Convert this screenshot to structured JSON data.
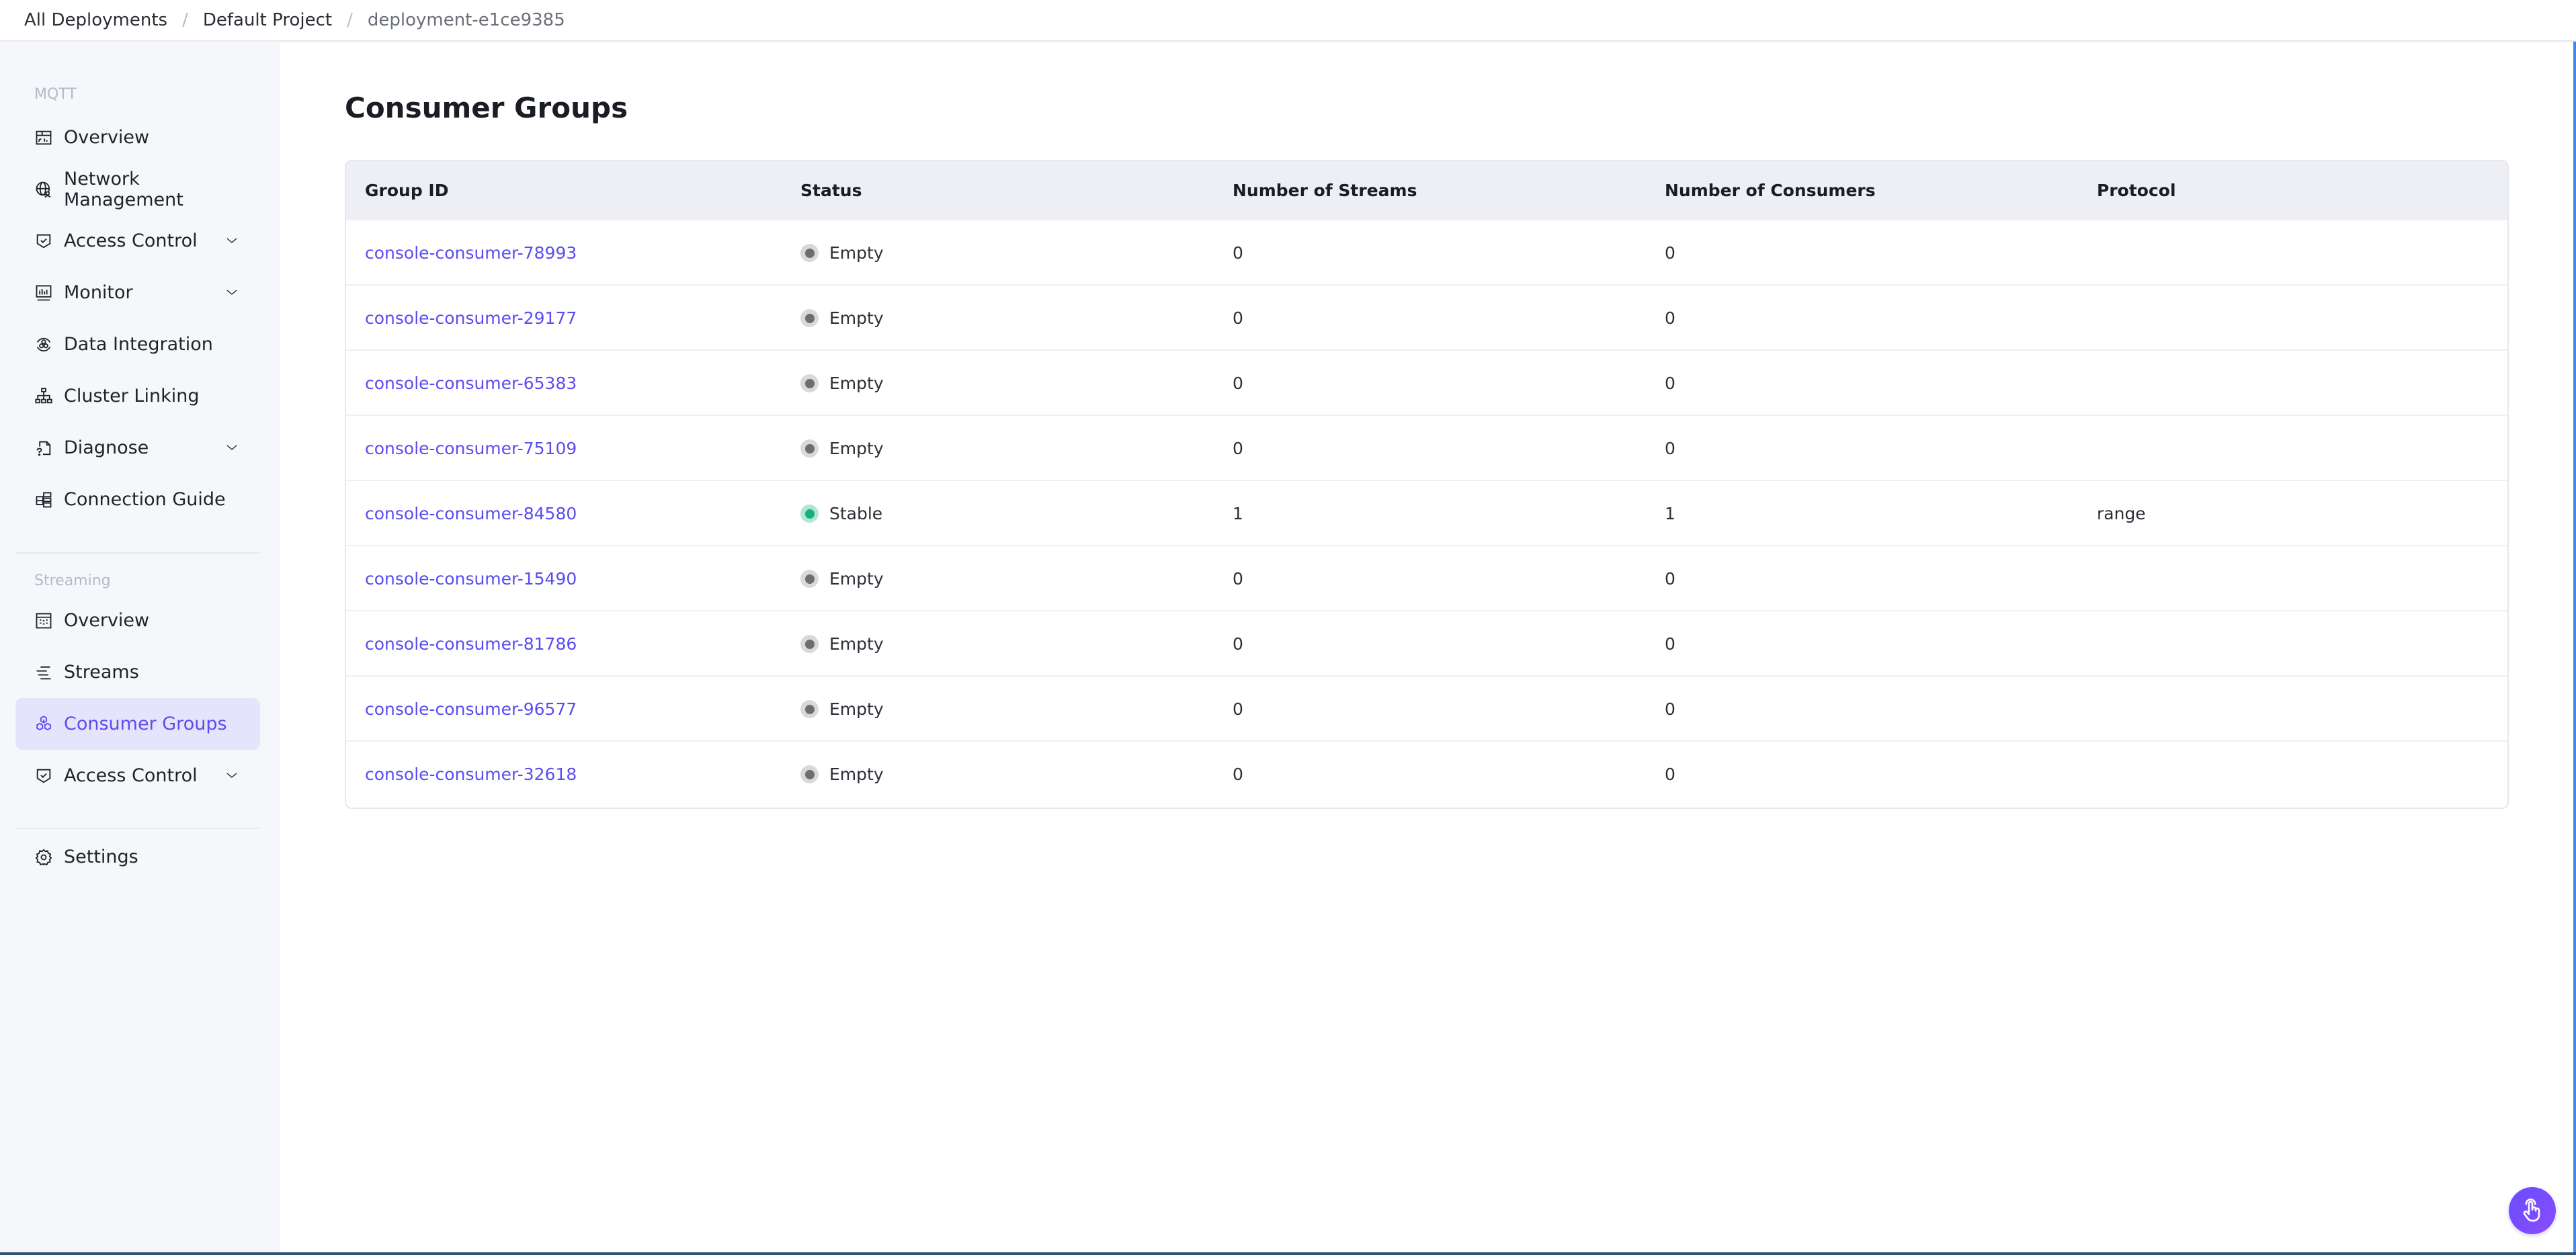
{
  "breadcrumb": {
    "items": [
      "All Deployments",
      "Default Project",
      "deployment-e1ce9385"
    ],
    "separator": "/"
  },
  "sidebar": {
    "sections": [
      {
        "label": "MQTT",
        "items": [
          {
            "label": "Overview",
            "icon": "dashboard-icon",
            "expandable": false
          },
          {
            "label": "Network Management",
            "icon": "network-globe-icon",
            "expandable": false
          },
          {
            "label": "Access Control",
            "icon": "shield-check-icon",
            "expandable": true
          },
          {
            "label": "Monitor",
            "icon": "monitor-chart-icon",
            "expandable": true
          },
          {
            "label": "Data Integration",
            "icon": "data-integration-icon",
            "expandable": false
          },
          {
            "label": "Cluster Linking",
            "icon": "cluster-tree-icon",
            "expandable": false
          },
          {
            "label": "Diagnose",
            "icon": "diagnose-file-icon",
            "expandable": true
          },
          {
            "label": "Connection Guide",
            "icon": "connection-guide-icon",
            "expandable": false
          }
        ]
      },
      {
        "label": "Streaming",
        "items": [
          {
            "label": "Overview",
            "icon": "stream-overview-icon",
            "expandable": false
          },
          {
            "label": "Streams",
            "icon": "streams-lines-icon",
            "expandable": false
          },
          {
            "label": "Consumer Groups",
            "icon": "cubes-icon",
            "expandable": false,
            "active": true
          },
          {
            "label": "Access Control",
            "icon": "shield-check-icon",
            "expandable": true
          }
        ]
      }
    ],
    "settings": {
      "label": "Settings",
      "icon": "gear-icon"
    }
  },
  "main": {
    "title": "Consumer Groups",
    "table": {
      "columns": [
        "Group ID",
        "Status",
        "Number of Streams",
        "Number of Consumers",
        "Protocol"
      ],
      "rows": [
        {
          "group_id": "console-consumer-78993",
          "status": "Empty",
          "streams": "0",
          "consumers": "0",
          "protocol": ""
        },
        {
          "group_id": "console-consumer-29177",
          "status": "Empty",
          "streams": "0",
          "consumers": "0",
          "protocol": ""
        },
        {
          "group_id": "console-consumer-65383",
          "status": "Empty",
          "streams": "0",
          "consumers": "0",
          "protocol": ""
        },
        {
          "group_id": "console-consumer-75109",
          "status": "Empty",
          "streams": "0",
          "consumers": "0",
          "protocol": ""
        },
        {
          "group_id": "console-consumer-84580",
          "status": "Stable",
          "streams": "1",
          "consumers": "1",
          "protocol": "range"
        },
        {
          "group_id": "console-consumer-15490",
          "status": "Empty",
          "streams": "0",
          "consumers": "0",
          "protocol": ""
        },
        {
          "group_id": "console-consumer-81786",
          "status": "Empty",
          "streams": "0",
          "consumers": "0",
          "protocol": ""
        },
        {
          "group_id": "console-consumer-96577",
          "status": "Empty",
          "streams": "0",
          "consumers": "0",
          "protocol": ""
        },
        {
          "group_id": "console-consumer-32618",
          "status": "Empty",
          "streams": "0",
          "consumers": "0",
          "protocol": ""
        }
      ]
    }
  },
  "status_colors": {
    "Empty": {
      "outer": "#d9d9d9",
      "inner": "#6e6e6e"
    },
    "Stable": {
      "outer": "#b3e6d2",
      "inner": "#12b27a"
    }
  },
  "colors": {
    "accent": "#5b4cf0",
    "active_bg": "#e6e4fc"
  },
  "fab": {
    "icon": "hand-pointer-icon"
  }
}
